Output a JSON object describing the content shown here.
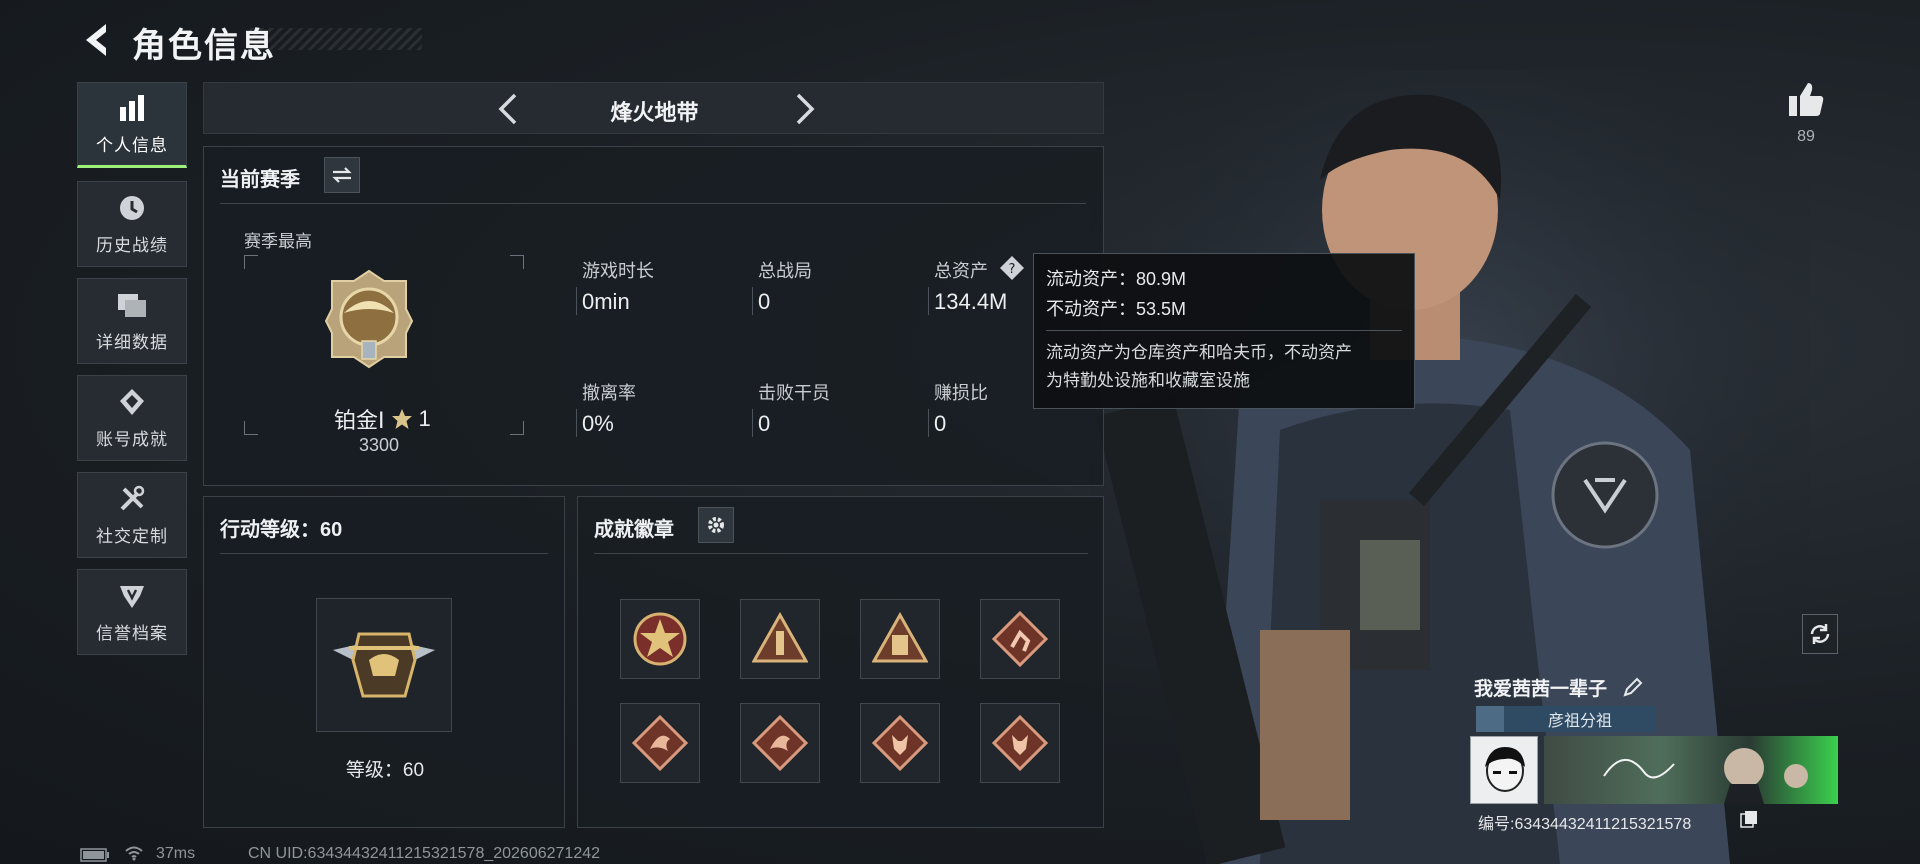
{
  "header": {
    "title": "角色信息"
  },
  "nav": [
    {
      "label": "个人信息",
      "icon": "bar-chart-icon",
      "active": true
    },
    {
      "label": "历史战绩",
      "icon": "clock-icon"
    },
    {
      "label": "详细数据",
      "icon": "folders-icon"
    },
    {
      "label": "账号成就",
      "icon": "achievement-icon"
    },
    {
      "label": "社交定制",
      "icon": "tools-icon"
    },
    {
      "label": "信誉档案",
      "icon": "credit-icon"
    }
  ],
  "mode": {
    "title": "烽火地带"
  },
  "season": {
    "title": "当前赛季",
    "best_label": "赛季最高",
    "rank_name": "铂金Ⅰ",
    "rank_stars": "1",
    "rank_points": "3300",
    "stats": [
      {
        "label": "游戏时长",
        "value": "0min"
      },
      {
        "label": "总战局",
        "value": "0"
      },
      {
        "label": "总资产",
        "value": "134.4M",
        "help": "?"
      },
      {
        "label": "撤离率",
        "value": "0%"
      },
      {
        "label": "击败干员",
        "value": "0"
      },
      {
        "label": "赚损比",
        "value": "0"
      }
    ]
  },
  "tooltip": {
    "liquid": "流动资产：80.9M",
    "fixed": "不动资产：53.5M",
    "desc1": "流动资产为仓库资产和哈夫币，不动资产",
    "desc2": "为特勤处设施和收藏室设施"
  },
  "level": {
    "title": "行动等级：60",
    "label": "等级：60"
  },
  "badges": {
    "title": "成就徽章",
    "items": [
      {
        "icon": "star-emblem-icon",
        "color": "#b5453a"
      },
      {
        "icon": "tower-triangle-icon",
        "color": "#c9a36a"
      },
      {
        "icon": "building-triangle-icon",
        "color": "#c9a36a"
      },
      {
        "icon": "runner-diamond-icon",
        "color": "#c77a5e"
      },
      {
        "icon": "dragon-diamond-icon",
        "color": "#c77a5e"
      },
      {
        "icon": "dragon-diamond-icon",
        "color": "#c77a5e"
      },
      {
        "icon": "wolf-diamond-icon",
        "color": "#c77a5e"
      },
      {
        "icon": "wolf-diamond-icon",
        "color": "#c77a5e"
      }
    ]
  },
  "likes": {
    "count": "89"
  },
  "player": {
    "name": "我爱茜茜一辈子",
    "tag": "彦祖分祖",
    "uid_label": "编号:63434432411215321578"
  },
  "status": {
    "ping": "37ms",
    "cn_uid": "CN UID:63434432411215321578_202606271242"
  },
  "colors": {
    "accent": "#9df07a",
    "panel_bg": "#181d22",
    "border": "#3a4148"
  }
}
